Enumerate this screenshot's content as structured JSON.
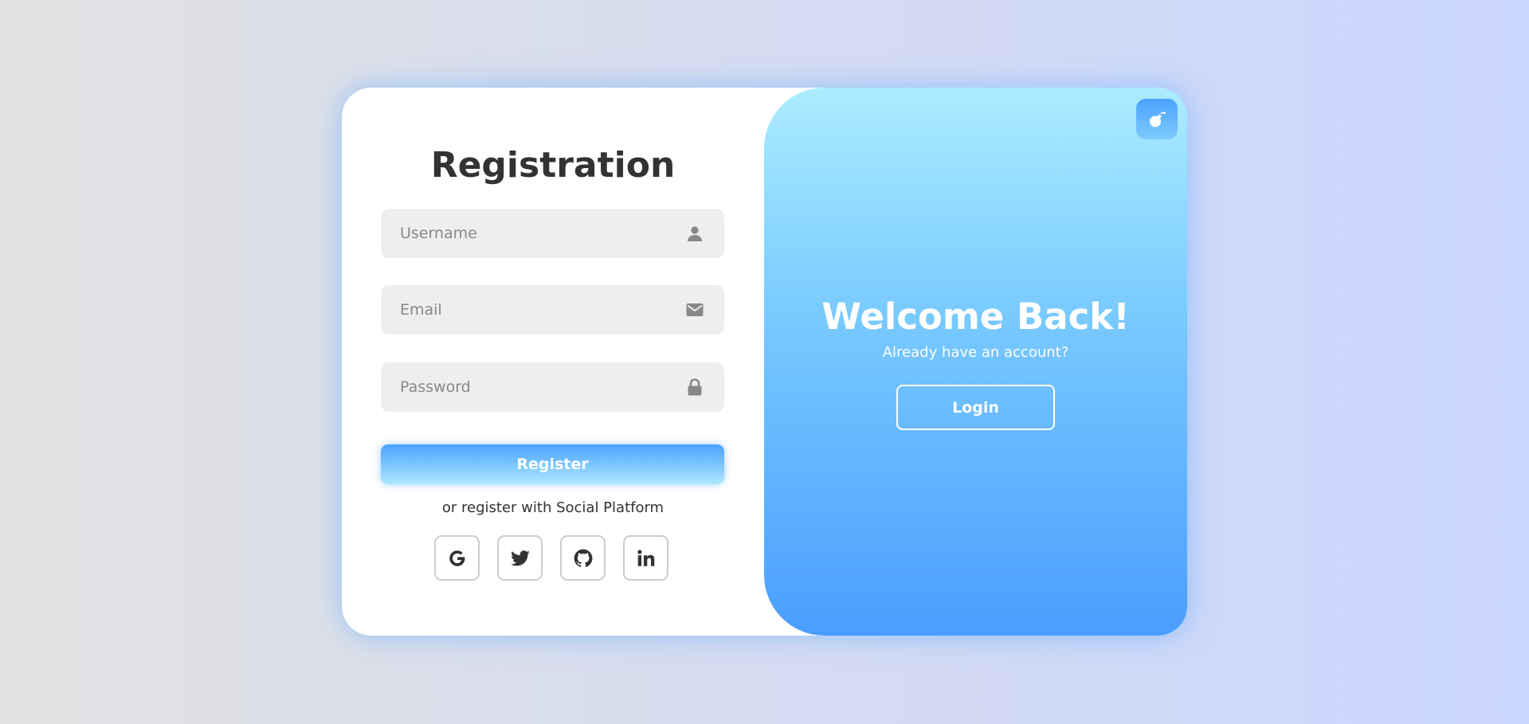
{
  "registration": {
    "title": "Registration",
    "fields": [
      {
        "placeholder": "Username",
        "icon": "user-icon"
      },
      {
        "placeholder": "Email",
        "icon": "envelope-icon"
      },
      {
        "placeholder": "Password",
        "icon": "lock-icon"
      }
    ],
    "register_label": "Register",
    "social_text": "or register with Social Platform",
    "socials": [
      {
        "icon": "google-icon"
      },
      {
        "icon": "twitter-icon"
      },
      {
        "icon": "github-icon"
      },
      {
        "icon": "linkedin-icon"
      }
    ]
  },
  "welcome": {
    "title": "Welcome Back!",
    "subtitle": "Already have an account?",
    "login_label": "Login"
  },
  "theme_toggle": {
    "icon": "bomb-icon"
  },
  "colors": {
    "accent": "#4a9dff",
    "accent_light": "#acecff",
    "text_dark": "#333333",
    "icon_gray": "#888888",
    "field_bg": "#eeeeee"
  }
}
